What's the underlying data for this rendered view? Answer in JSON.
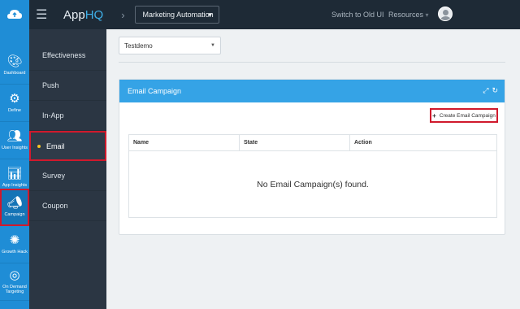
{
  "header": {
    "brand_app": "App",
    "brand_hq": "HQ",
    "breadcrumb_chevron": "›",
    "app_select": "Marketing Automation",
    "switch_link": "Switch to Old UI",
    "resources_link": "Resources",
    "resources_caret": "▾"
  },
  "rail": {
    "items": [
      {
        "label": "Dashboard",
        "icon": "palette-icon"
      },
      {
        "label": "Define",
        "icon": "gears-icon"
      },
      {
        "label": "User Insights",
        "icon": "users-eye-icon"
      },
      {
        "label": "App Insights",
        "icon": "chart-eye-icon"
      },
      {
        "label": "Campaign",
        "icon": "megaphone-icon"
      },
      {
        "label": "Growth Hack",
        "icon": "splash-icon"
      },
      {
        "label": "On Demand Targeting",
        "icon": "target-icon"
      }
    ],
    "active": "Campaign"
  },
  "menu": {
    "items": [
      "Effectiveness",
      "Push",
      "In-App",
      "Email",
      "Survey",
      "Coupon"
    ],
    "active": "Email"
  },
  "content": {
    "app_dropdown": "Testdemo",
    "panel_title": "Email Campaign",
    "create_button": "Create Email Campaign",
    "columns": [
      "Name",
      "State",
      "Action"
    ],
    "empty_message": "No Email Campaign(s) found."
  },
  "colors": {
    "accent": "#1f8dd6",
    "panel_header": "#35a3e6",
    "highlight_border": "#d0192c",
    "topbar": "#1e2a36",
    "menu_bg": "#2b3643"
  }
}
